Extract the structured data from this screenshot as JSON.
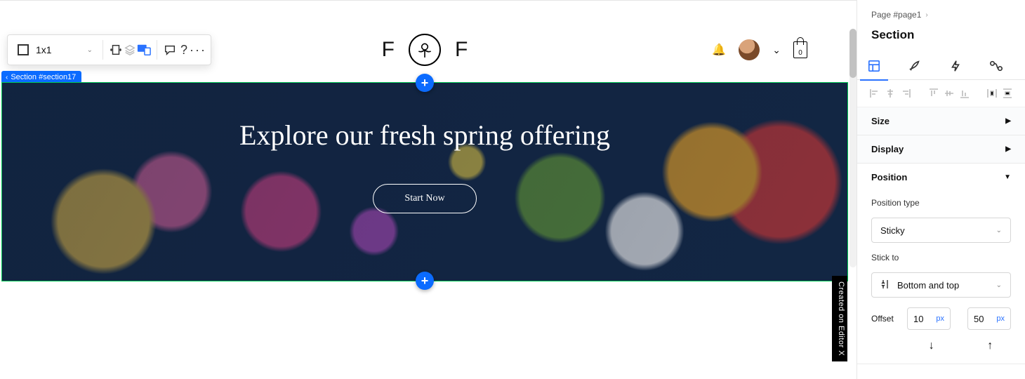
{
  "breadcrumb": {
    "label": "Page #page1"
  },
  "inspector": {
    "title": "Section",
    "tabs": [
      "layout",
      "design",
      "animation",
      "interactions"
    ],
    "accordions": {
      "size": "Size",
      "display": "Display",
      "position": "Position"
    },
    "position": {
      "type_label": "Position type",
      "type_value": "Sticky",
      "stick_label": "Stick to",
      "stick_value": "Bottom and top",
      "offset_label": "Offset",
      "offset1_value": "10",
      "offset1_unit": "px",
      "offset2_value": "50",
      "offset2_unit": "px"
    }
  },
  "toolbar": {
    "grid_label": "1x1"
  },
  "section_tag": "Section #section17",
  "hero": {
    "title": "Explore our fresh spring offering",
    "cta": "Start Now"
  },
  "header": {
    "letter_left": "F",
    "letter_right": "F",
    "bag_count": "0"
  },
  "watermark": "Created on Editor X"
}
